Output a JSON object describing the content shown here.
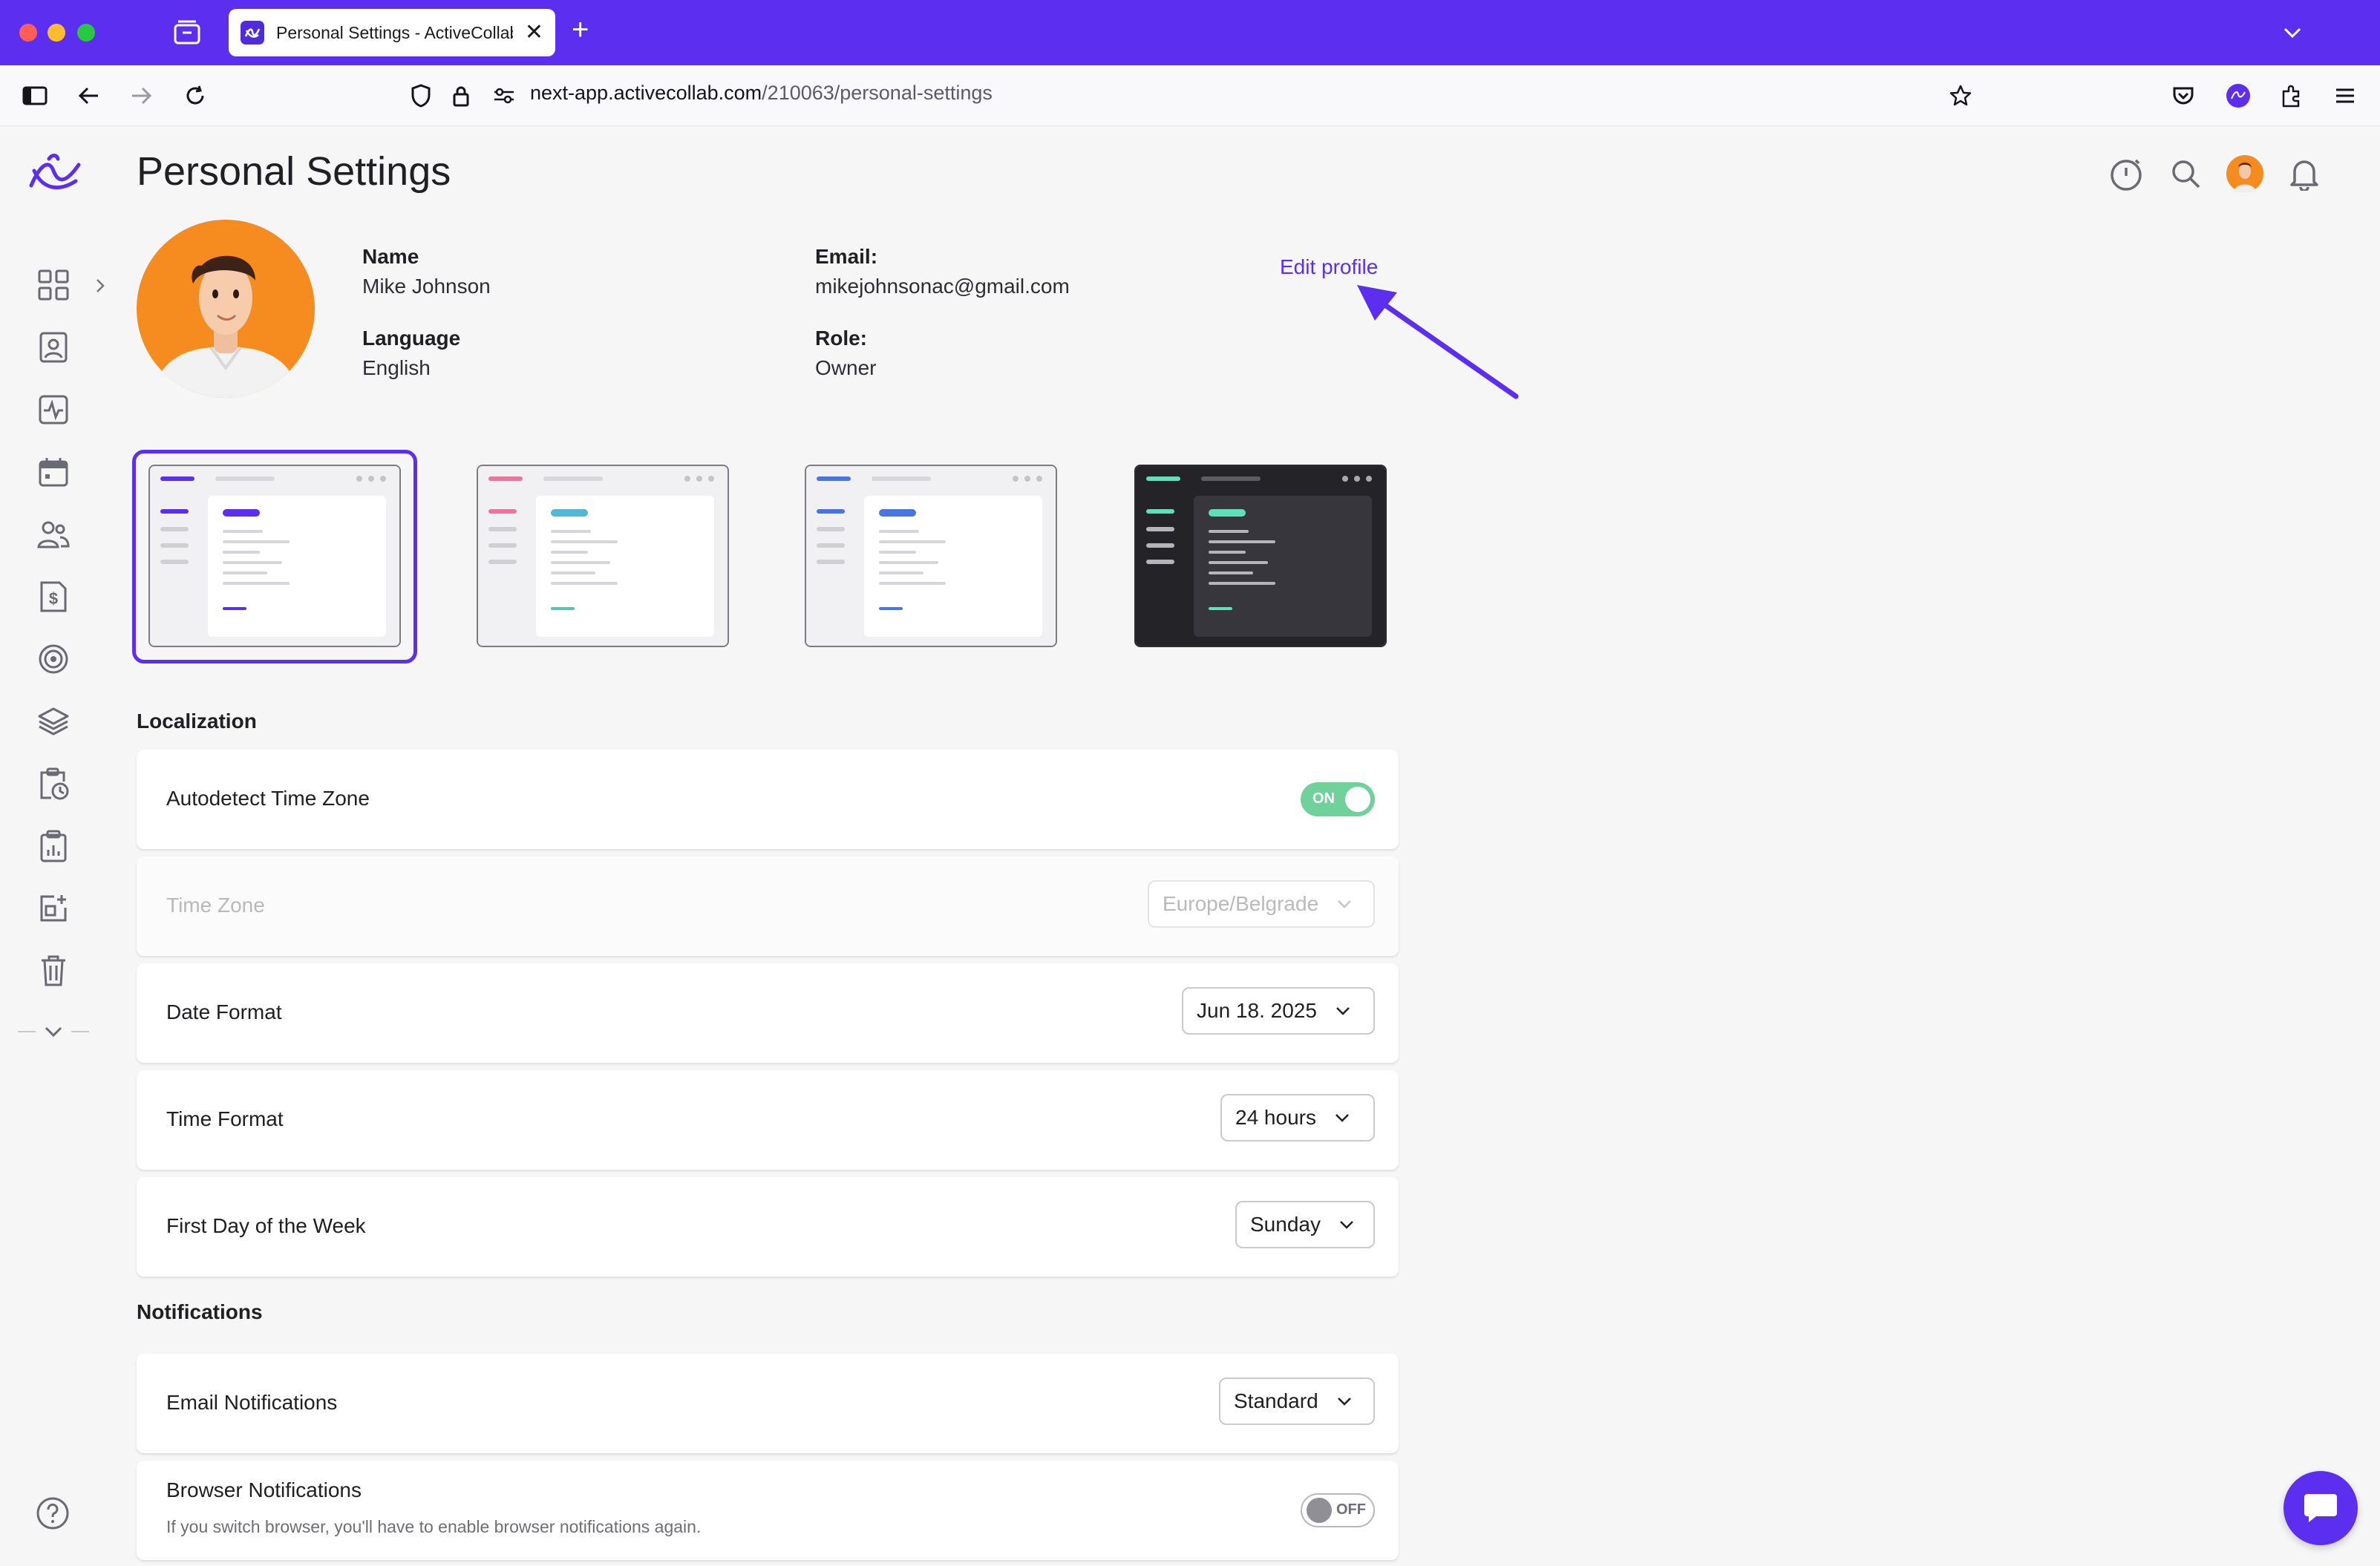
{
  "browser": {
    "tab_title": "Personal Settings - ActiveCollab",
    "tab_close": "✕",
    "new_tab": "+",
    "url_host": "next-app.activecollab.com",
    "url_path": "/210063/personal-settings"
  },
  "page": {
    "title": "Personal Settings"
  },
  "profile": {
    "name_label": "Name",
    "name_value": "Mike Johnson",
    "language_label": "Language",
    "language_value": "English",
    "email_label": "Email:",
    "email_value": "mikejohnsonac@gmail.com",
    "role_label": "Role:",
    "role_value": "Owner",
    "edit_link": "Edit profile"
  },
  "themes": [
    {
      "name": "purple-light",
      "accent": "#5b2ef0",
      "selected": true
    },
    {
      "name": "pink-light",
      "accent": "#f0739c",
      "selected": false
    },
    {
      "name": "blue-light",
      "accent": "#4a74e0",
      "selected": false
    },
    {
      "name": "dark",
      "accent": "#5fe0b8",
      "selected": false
    }
  ],
  "localization": {
    "title": "Localization",
    "autodetect_label": "Autodetect Time Zone",
    "autodetect_state": "ON",
    "timezone_label": "Time Zone",
    "timezone_value": "Europe/Belgrade",
    "date_format_label": "Date Format",
    "date_format_value": "Jun 18. 2025",
    "time_format_label": "Time Format",
    "time_format_value": "24 hours",
    "first_day_label": "First Day of the Week",
    "first_day_value": "Sunday"
  },
  "notifications": {
    "title": "Notifications",
    "email_label": "Email Notifications",
    "email_value": "Standard",
    "browser_label": "Browser Notifications",
    "browser_sub": "If you switch browser, you'll have to enable browser notifications again.",
    "browser_state": "OFF"
  },
  "colors": {
    "brand": "#5b2ef0",
    "toggle_on": "#71d19a",
    "avatar_bg": "#f68b1f"
  },
  "icons": {
    "sidebar": [
      "dashboard-icon",
      "profile-card-icon",
      "activity-icon",
      "calendar-icon",
      "people-icon",
      "invoice-icon",
      "target-icon",
      "layers-icon",
      "timesheet-icon",
      "reports-icon",
      "add-widget-icon",
      "trash-icon"
    ],
    "top_actions": [
      "timer-icon",
      "search-icon",
      "user-avatar",
      "bell-icon"
    ]
  }
}
